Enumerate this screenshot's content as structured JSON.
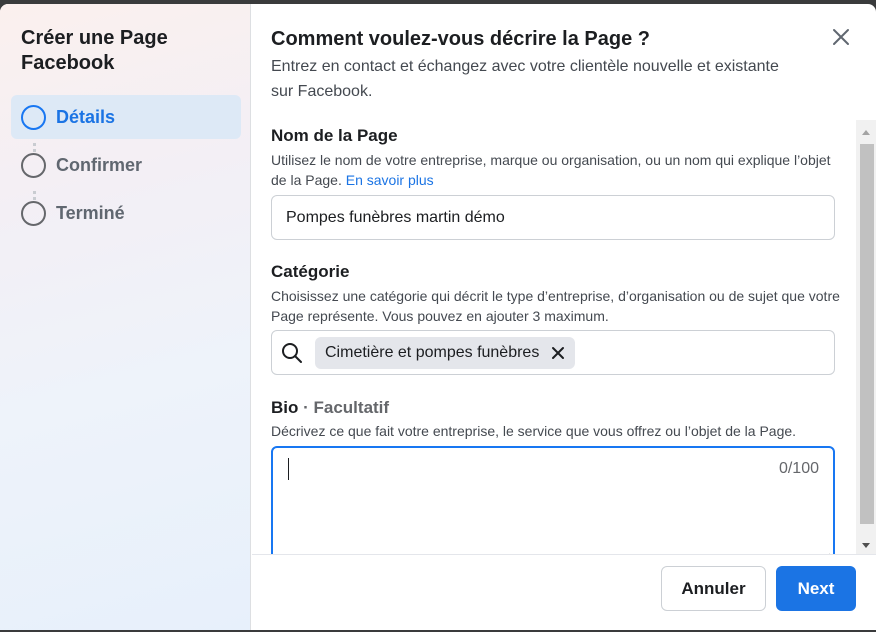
{
  "sidebar": {
    "title": "Créer une Page Facebook",
    "steps": [
      {
        "label": "Détails",
        "active": true
      },
      {
        "label": "Confirmer",
        "active": false
      },
      {
        "label": "Terminé",
        "active": false
      }
    ]
  },
  "header": {
    "title": "Comment voulez-vous décrire la Page ?",
    "subtitle": "Entrez en contact et échangez avec votre clientèle nouvelle et existante sur Facebook."
  },
  "page_name": {
    "label": "Nom de la Page",
    "help": "Utilisez le nom de votre entreprise, marque ou organisation, ou un nom qui explique l’objet de la Page.",
    "help_link": "En savoir plus",
    "value": "Pompes funèbres martin démo"
  },
  "category": {
    "label": "Catégorie",
    "help": "Choisissez une catégorie qui décrit le type d’entreprise, d’organisation ou de sujet que votre Page représente. Vous pouvez en ajouter 3 maximum.",
    "selected": "Cimetière et pompes funèbres"
  },
  "bio": {
    "label": "Bio",
    "optional": "· Facultatif",
    "help": "Décrivez ce que fait votre entreprise, le service que vous offrez ou l’objet de la Page.",
    "value": "",
    "counter": "0/100"
  },
  "footer": {
    "cancel_label": "Annuler",
    "next_label": "Next"
  },
  "colors": {
    "accent": "#1b74e4",
    "active_step_bg": "#dde9f6"
  }
}
